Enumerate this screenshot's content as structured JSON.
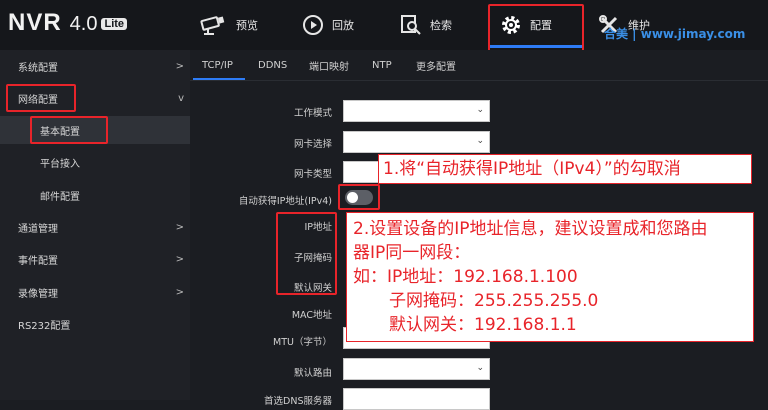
{
  "logo": {
    "brand": "NVR",
    "version": "4.0",
    "badge": "Lite"
  },
  "nav": {
    "items": [
      {
        "label": "预览",
        "icon": "camera-icon"
      },
      {
        "label": "回放",
        "icon": "playback-icon"
      },
      {
        "label": "检索",
        "icon": "search-doc-icon"
      },
      {
        "label": "配置",
        "icon": "gear-icon"
      },
      {
        "label": "维护",
        "icon": "wrench-icon"
      }
    ],
    "active": "配置"
  },
  "watermark": "合美 | www.jimay.com",
  "sidebar": {
    "items": [
      {
        "label": "系统配置",
        "chevron": ">"
      },
      {
        "label": "网络配置",
        "chevron": "v"
      },
      {
        "label": "基本配置",
        "chevron": ""
      },
      {
        "label": "平台接入",
        "chevron": ""
      },
      {
        "label": "邮件配置",
        "chevron": ""
      },
      {
        "label": "通道管理",
        "chevron": ">"
      },
      {
        "label": "事件配置",
        "chevron": ">"
      },
      {
        "label": "录像管理",
        "chevron": ">"
      },
      {
        "label": "RS232配置",
        "chevron": ""
      }
    ]
  },
  "tabs": [
    "TCP/IP",
    "DDNS",
    "端口映射",
    "NTP",
    "更多配置"
  ],
  "form": {
    "labels": {
      "work_mode": "工作模式",
      "nic_select": "网卡选择",
      "nic_type": "网卡类型",
      "dhcp": "自动获得IP地址(IPv4)",
      "ip": "IP地址",
      "mask": "子网掩码",
      "gateway": "默认网关",
      "mac": "MAC地址",
      "mtu": "MTU（字节）",
      "route": "默认路由",
      "dns": "首选DNS服务器"
    },
    "dhcp_enabled": false
  },
  "notes": {
    "note1": "1.将“自动获得IP地址（IPv4）”的勾取消",
    "note2": [
      "2.设置设备的IP地址信息，建议设置成和您路由",
      "器IP同一网段：",
      "如：IP地址：192.168.1.100",
      "子网掩码：255.255.255.0",
      "默认网关：192.168.1.1"
    ]
  },
  "colors": {
    "accent": "#2e7cf6",
    "annotation": "#e8242a"
  }
}
